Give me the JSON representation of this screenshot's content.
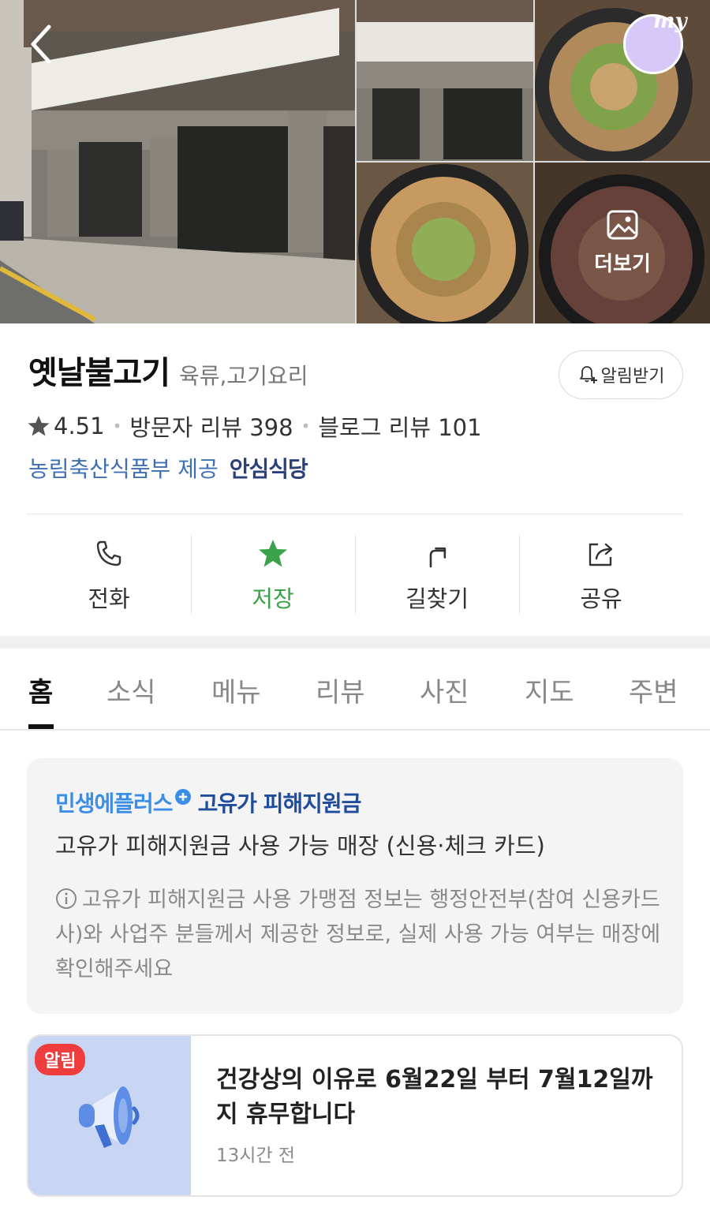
{
  "gallery": {
    "more_label": "더보기",
    "my_label": "my",
    "accent_avatar": "#d6c9f7"
  },
  "place": {
    "name": "옛날불고기",
    "category": "육류,고기요리",
    "alert_label": "알림받기",
    "rating": "4.51",
    "visitor_reviews": "방문자 리뷰 398",
    "blog_reviews": "블로그 리뷰 101",
    "cert_provider": "농림축산식품부 제공",
    "cert_badge": "안심식당"
  },
  "actions": [
    {
      "label": "전화",
      "icon": "phone-icon"
    },
    {
      "label": "저장",
      "icon": "star-icon",
      "active": true
    },
    {
      "label": "길찾기",
      "icon": "directions-icon"
    },
    {
      "label": "공유",
      "icon": "share-icon"
    }
  ],
  "tabs": [
    "홈",
    "소식",
    "메뉴",
    "리뷰",
    "사진",
    "지도",
    "주변"
  ],
  "active_tab": "홈",
  "support": {
    "brand": "민생에플러스",
    "program": "고유가 피해지원금",
    "description": "고유가 피해지원금 사용 가능 매장 (신용·체크 카드)",
    "note": "고유가 피해지원금 사용 가맹점 정보는 행정안전부(참여 신용카드사)와 사업주 분들께서 제공한 정보로, 실제 사용 가능 여부는 매장에 확인해주세요"
  },
  "notice": {
    "badge": "알림",
    "text": "건강상의 이유로 6월22일 부터 7월12일까지 휴무합니다",
    "time": "13시간 전"
  },
  "colors": {
    "save_active": "#3aa34a",
    "cert_provider": "#3f6fb3",
    "notice_badge": "#ef3d3d"
  }
}
